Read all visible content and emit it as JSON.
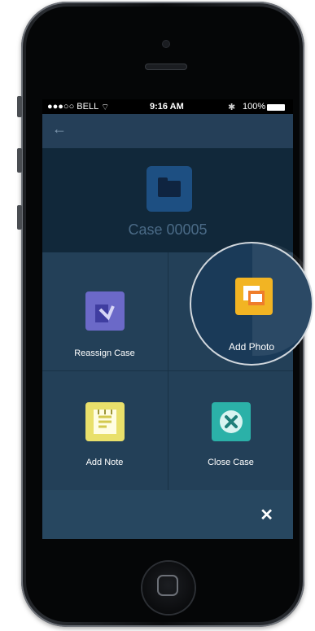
{
  "status_bar": {
    "carrier": "●●●○○ BELL",
    "wifi": "⌔",
    "time": "9:16 AM",
    "bluetooth": "✱",
    "battery": "100%"
  },
  "nav": {
    "back_icon": "arrow-left-icon"
  },
  "case": {
    "title": "Case 00005",
    "icon": "folder-icon",
    "icon_color": "#1d4f82"
  },
  "actions": [
    {
      "label": "Reassign Case",
      "icon": "reassign-icon",
      "color": "#6b69c8"
    },
    {
      "label": "Add Photo",
      "icon": "photo-icon",
      "color": "#f2b423"
    },
    {
      "label": "Add Note",
      "icon": "note-icon",
      "color": "#e9e06b"
    },
    {
      "label": "Close Case",
      "icon": "close-circle-icon",
      "color": "#2bb1a8"
    }
  ],
  "footer": {
    "close_label": "✕"
  }
}
